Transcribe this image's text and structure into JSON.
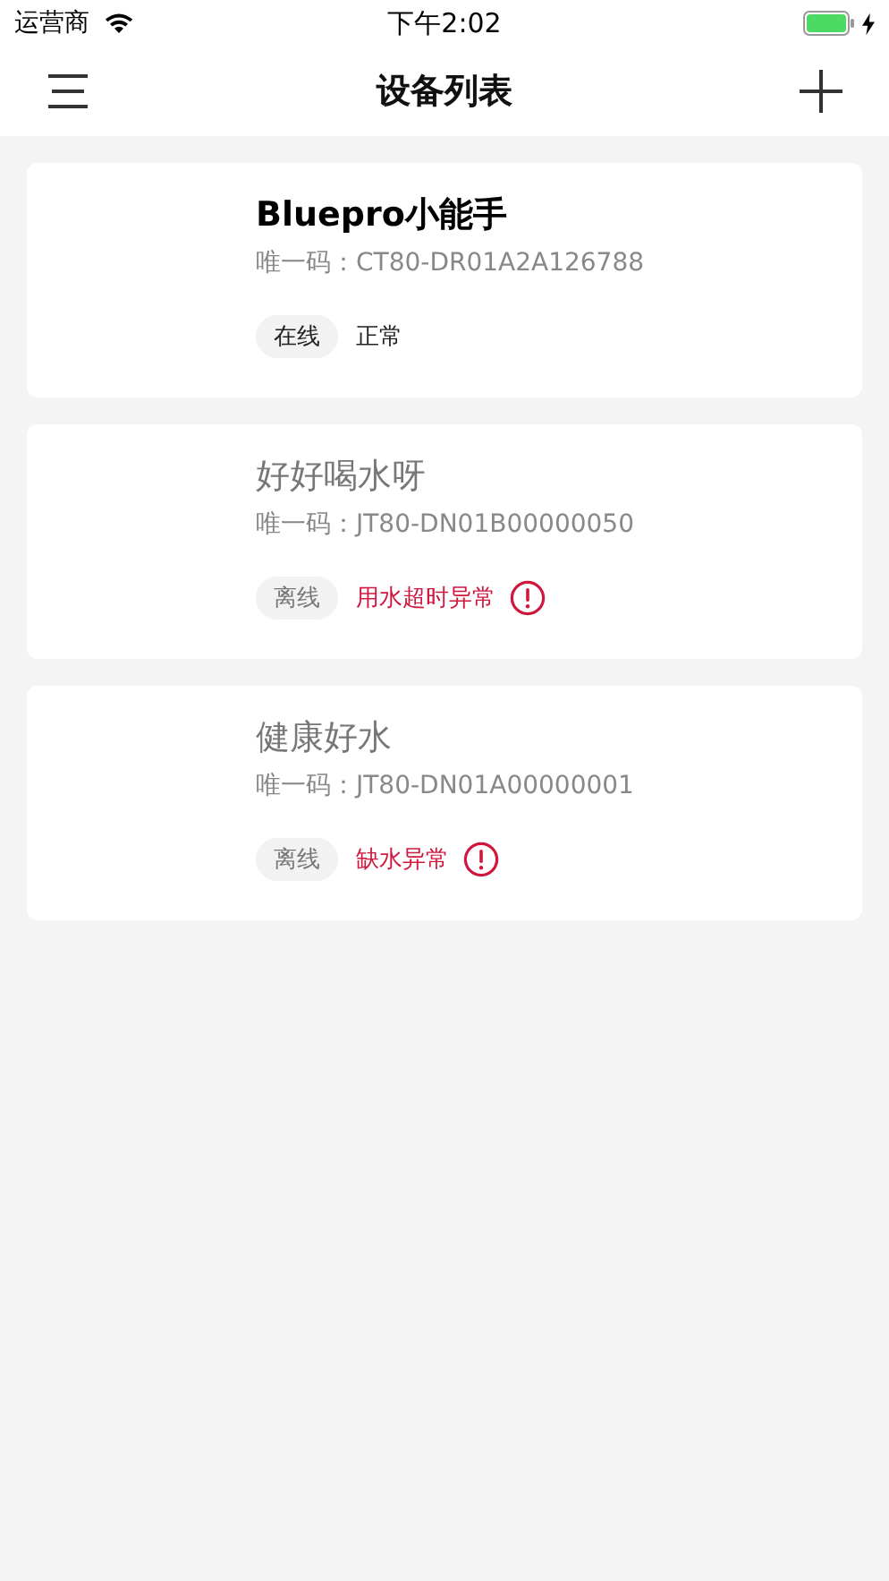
{
  "status_bar": {
    "carrier": "运营商",
    "time": "下午2:02",
    "charging": true
  },
  "nav": {
    "title": "设备列表"
  },
  "devices": [
    {
      "name": "Bluepro小能手",
      "code": "唯一码：CT80-DR01A2A126788",
      "online": true,
      "connection": "在线",
      "status": "正常",
      "alert": false
    },
    {
      "name": "好好喝水呀",
      "code": "唯一码：JT80-DN01B00000050",
      "online": false,
      "connection": "离线",
      "status": "用水超时异常",
      "alert": true
    },
    {
      "name": "健康好水",
      "code": "唯一码：JT80-DN01A00000001",
      "online": false,
      "connection": "离线",
      "status": "缺水异常",
      "alert": true
    }
  ]
}
